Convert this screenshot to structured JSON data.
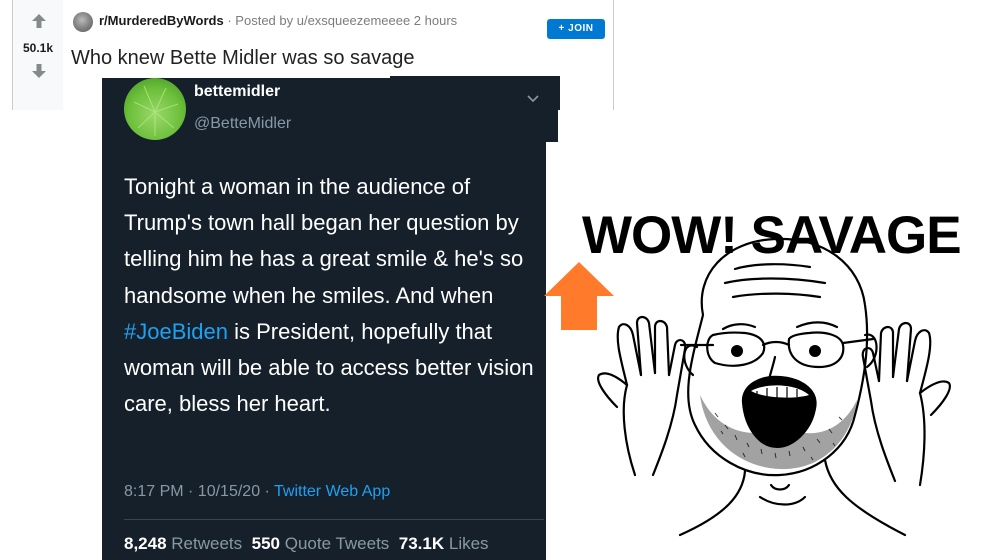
{
  "reddit": {
    "vote_count": "50.1k",
    "subreddit": "r/MurderedByWords",
    "posted_by": "· Posted by u/exsqueezemeeee 2 hours",
    "join_label": "+ JOIN",
    "post_title": "Who knew Bette Midler was so savage"
  },
  "tweet": {
    "display_name": "bettemidler",
    "handle": "@BetteMidler",
    "text_before": "Tonight a woman in the audience of Trump's town hall began her question by telling him he has a great smile & he's so handsome when he smiles. And when ",
    "hashtag": "#JoeBiden",
    "text_after": " is President, hopefully that woman will be able to access better vision care, bless her heart.",
    "timestamp": "8:17 PM · 10/15/20 · ",
    "client": "Twitter Web App",
    "retweets_count": "8,248",
    "retweets_label": "Retweets",
    "quotes_count": "550",
    "quotes_label": "Quote Tweets",
    "likes_count": "73.1K",
    "likes_label": "Likes"
  },
  "meme": {
    "caption": "WOW! SAVAGE"
  },
  "colors": {
    "join_blue": "#0079d3",
    "tweet_bg": "#15202b",
    "twitter_blue": "#1da1f2",
    "arrow_orange": "#ff7a2b"
  },
  "icons": [
    "upvote-arrow-icon",
    "downvote-arrow-icon",
    "subreddit-avatar",
    "chevron-down-icon",
    "orange-upvote-arrow-icon"
  ]
}
